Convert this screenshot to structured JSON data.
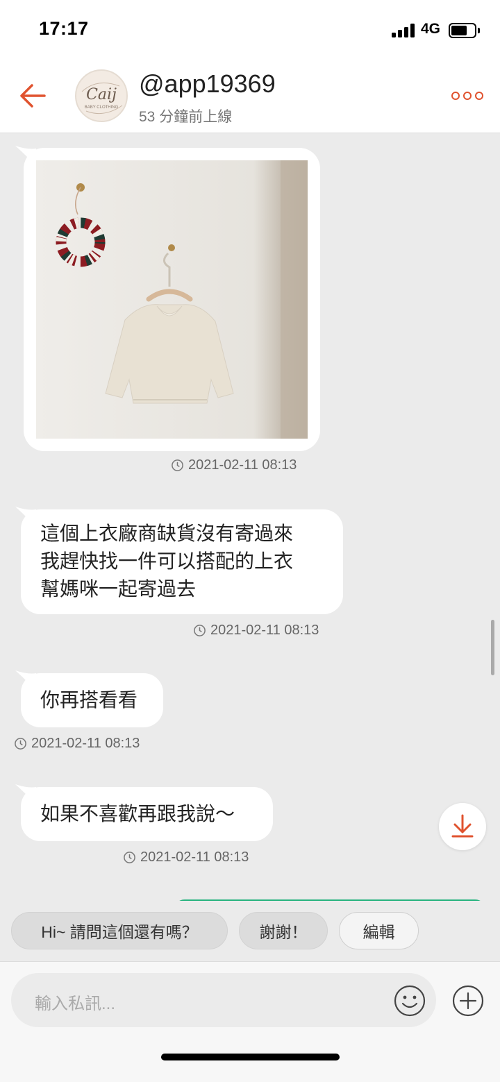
{
  "status_bar": {
    "time": "17:17",
    "network": "4G"
  },
  "header": {
    "username": "@app19369",
    "online_status": "53 分鐘前上線",
    "avatar_text": "Caij",
    "avatar_subtext": "BABY CLOTHING",
    "back_icon": "back-arrow-icon",
    "more_icon": "more-dots-icon"
  },
  "messages": [
    {
      "type": "image",
      "image_description": "wreath-and-cream-blouse-photo",
      "timestamp": "2021-02-11 08:13"
    },
    {
      "type": "text",
      "text": "這個上衣廠商缺貨沒有寄過來\n我趕快找一件可以搭配的上衣\n幫媽咪一起寄過去",
      "timestamp": "2021-02-11 08:13"
    },
    {
      "type": "text",
      "text": "你再搭看看",
      "timestamp": "2021-02-11 08:13"
    },
    {
      "type": "text",
      "text": "如果不喜歡再跟我說～",
      "timestamp": "2021-02-11 08:13"
    }
  ],
  "quick_replies": [
    {
      "label": "Hi~ 請問這個還有嗎？"
    },
    {
      "label": "謝謝！"
    },
    {
      "label": "編輯"
    }
  ],
  "input": {
    "placeholder": "輸入私訊...",
    "emoji_icon": "smiley-icon",
    "plus_icon": "plus-circle-icon"
  },
  "colors": {
    "accent": "#e0532f",
    "bubble": "#ffffff",
    "chat_background": "#ebebeb",
    "outgoing_border": "#27b37f"
  }
}
